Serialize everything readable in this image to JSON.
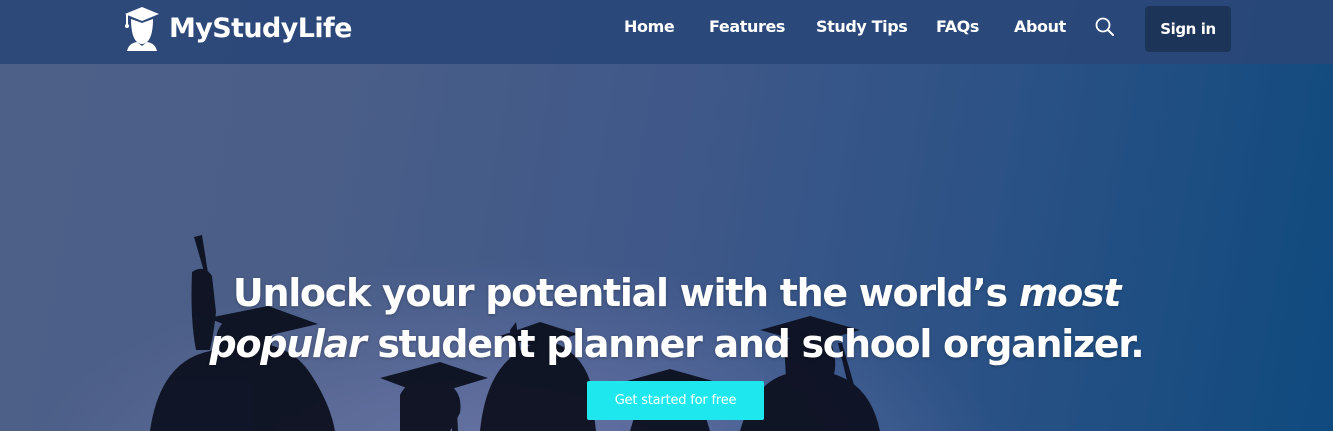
{
  "brand": {
    "name": "MyStudyLife",
    "logo_icon": "graduate-head-icon"
  },
  "nav": {
    "items": [
      {
        "label": "Home"
      },
      {
        "label": "Features"
      },
      {
        "label": "Study Tips"
      },
      {
        "label": "FAQs"
      },
      {
        "label": "About"
      }
    ],
    "search_icon": "search-icon",
    "signin_label": "Sign in"
  },
  "hero": {
    "headline_part1": "Unlock your potential with the world’s ",
    "headline_emphasis": "most popular",
    "headline_part2": " student planner and school organizer.",
    "cta_label": "Get started for free",
    "background_image": "graduates-silhouette-at-dusk"
  },
  "colors": {
    "nav_bg": "#2a4778",
    "signin_bg": "#1d3459",
    "cta_bg": "#1ee8ee",
    "hero_left": "#4d6088",
    "hero_right": "#0f4a7e"
  }
}
